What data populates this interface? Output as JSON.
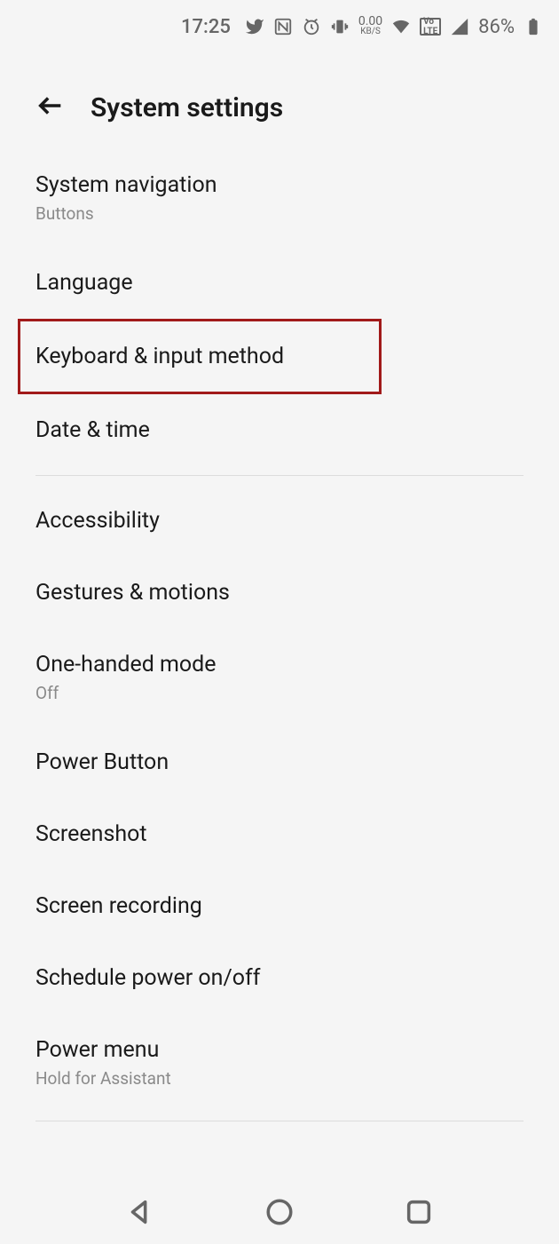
{
  "status": {
    "time": "17:25",
    "data_rate": "0.00",
    "data_unit": "KB/S",
    "volte": "Vo LTE",
    "battery_pct": "86%"
  },
  "header": {
    "title": "System settings"
  },
  "group1": [
    {
      "label": "System navigation",
      "sub": "Buttons",
      "highlight": false
    },
    {
      "label": "Language",
      "sub": null,
      "highlight": false
    },
    {
      "label": "Keyboard & input method",
      "sub": null,
      "highlight": true
    },
    {
      "label": "Date & time",
      "sub": null,
      "highlight": false
    }
  ],
  "group2": [
    {
      "label": "Accessibility",
      "sub": null
    },
    {
      "label": "Gestures & motions",
      "sub": null
    },
    {
      "label": "One-handed mode",
      "sub": "Off"
    },
    {
      "label": "Power Button",
      "sub": null
    },
    {
      "label": "Screenshot",
      "sub": null
    },
    {
      "label": "Screen recording",
      "sub": null
    },
    {
      "label": "Schedule power on/off",
      "sub": null
    },
    {
      "label": "Power menu",
      "sub": "Hold for Assistant"
    }
  ]
}
